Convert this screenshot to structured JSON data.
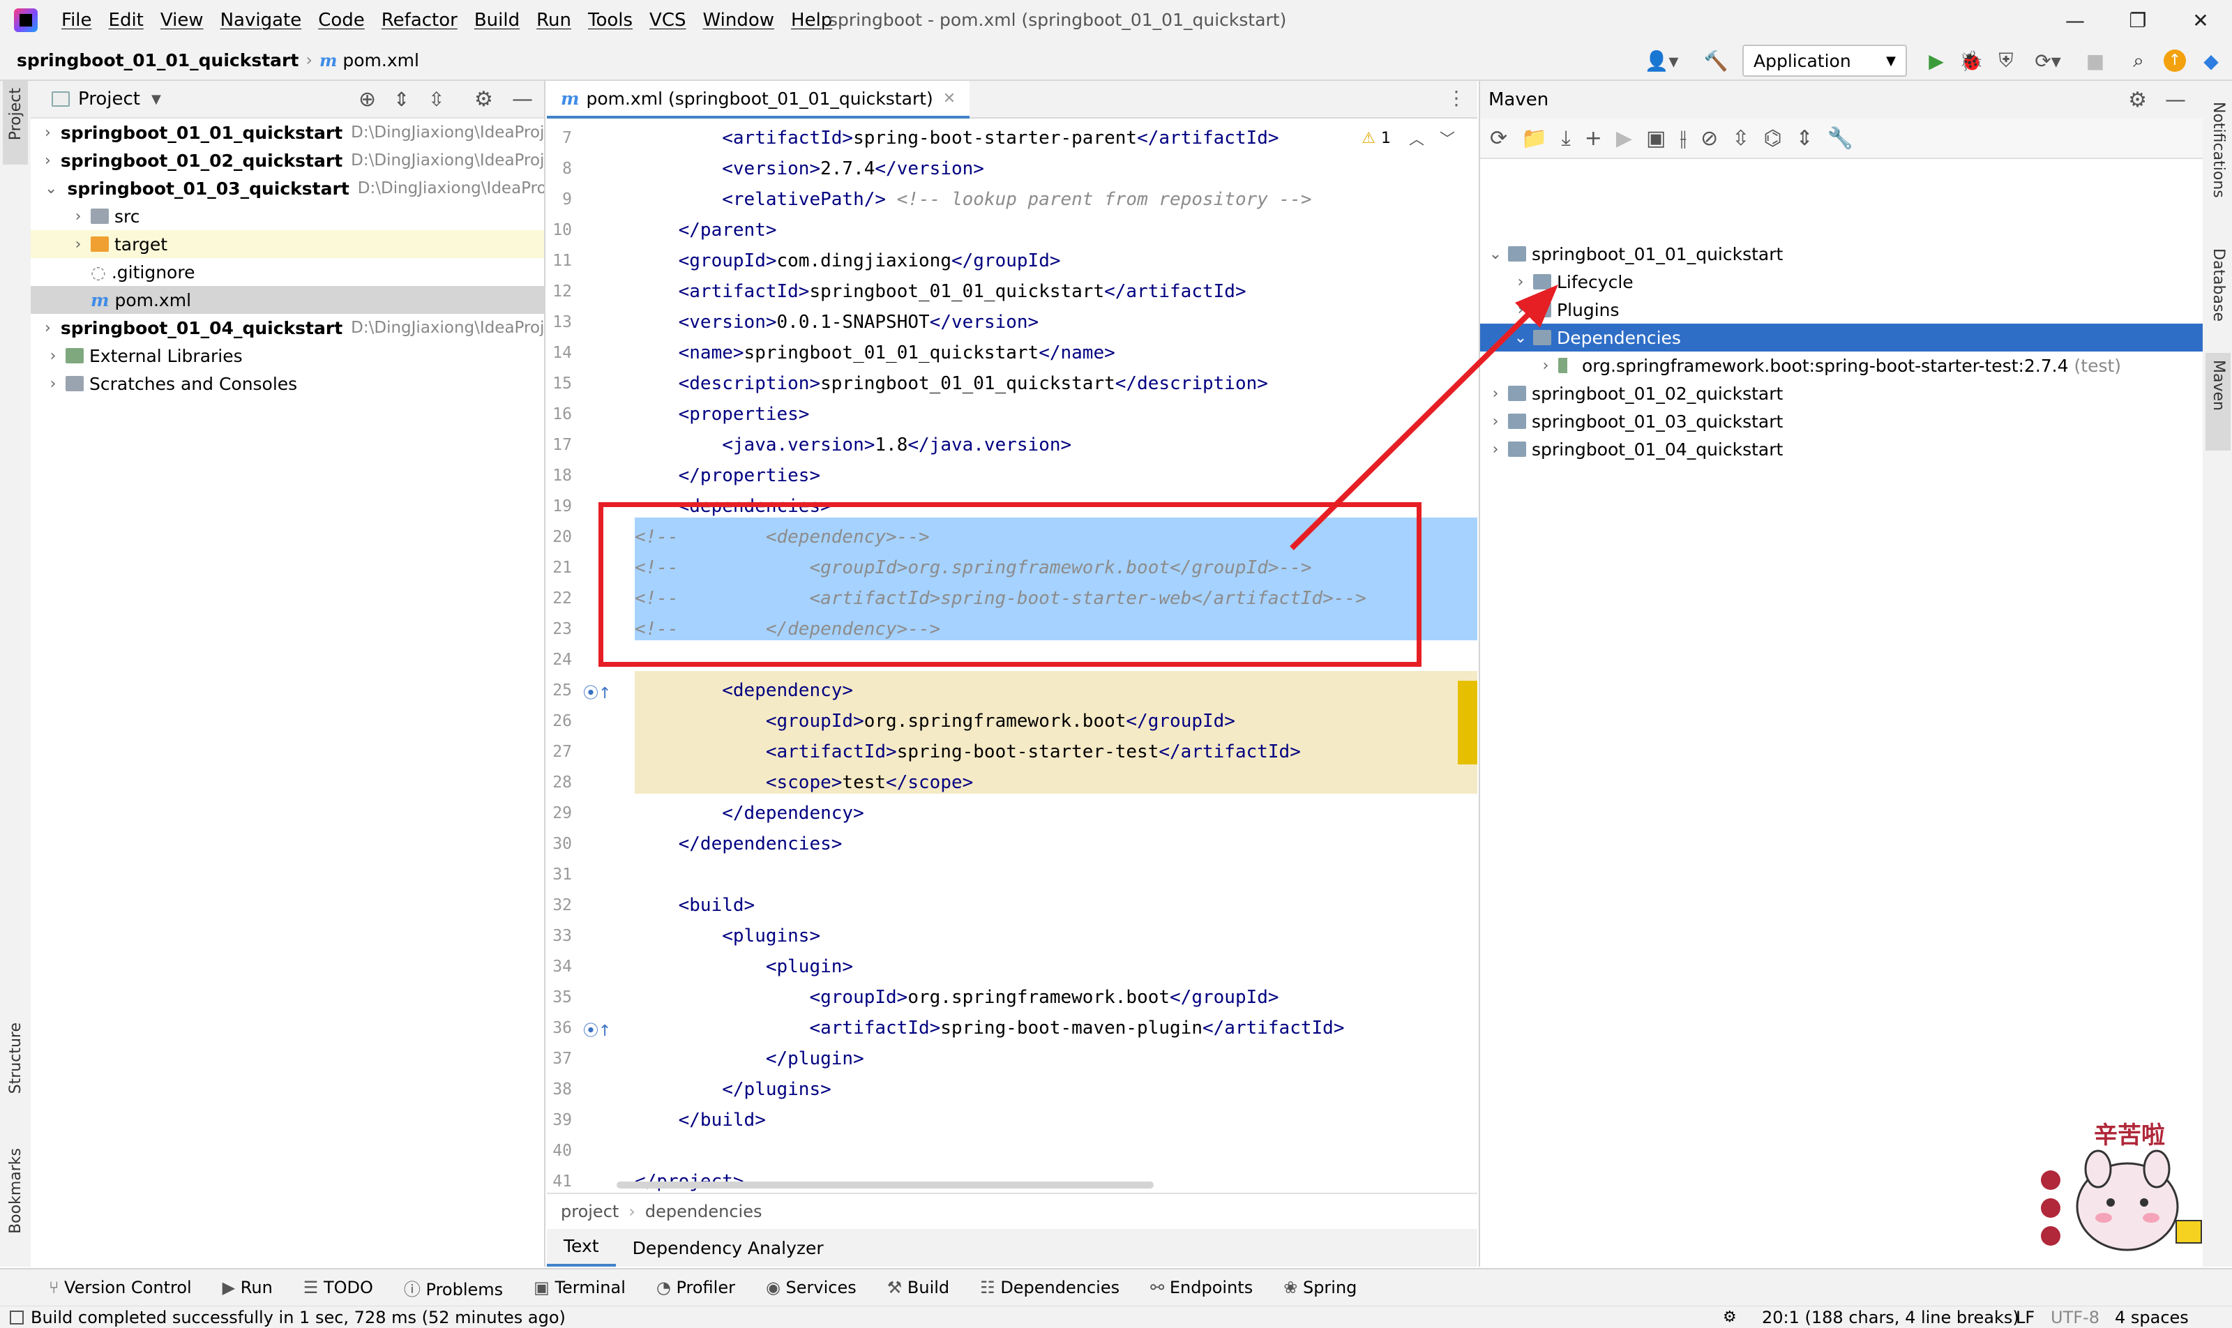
{
  "menu": [
    "File",
    "Edit",
    "View",
    "Navigate",
    "Code",
    "Refactor",
    "Build",
    "Run",
    "Tools",
    "VCS",
    "Window",
    "Help"
  ],
  "window_title": "springboot - pom.xml (springboot_01_01_quickstart)",
  "breadcrumb": {
    "project": "springboot_01_01_quickstart",
    "file": "pom.xml"
  },
  "run_config": "Application",
  "project_panel": {
    "title": "Project",
    "rows": [
      {
        "label": "springboot_01_01_quickstart",
        "path": "D:\\DingJiaxiong\\IdeaProje",
        "bold": true
      },
      {
        "label": "springboot_01_02_quickstart",
        "path": "D:\\DingJiaxiong\\IdeaProje",
        "bold": true
      },
      {
        "label": "springboot_01_03_quickstart",
        "path": "D:\\DingJiaxiong\\IdeaProje",
        "bold": true
      },
      {
        "label": "src"
      },
      {
        "label": "target"
      },
      {
        "label": ".gitignore"
      },
      {
        "label": "pom.xml"
      },
      {
        "label": "springboot_01_04_quickstart",
        "path": "D:\\DingJiaxiong\\IdeaProje",
        "bold": true
      },
      {
        "label": "External Libraries"
      },
      {
        "label": "Scratches and Consoles"
      }
    ]
  },
  "left_stripe": {
    "top": "Project",
    "structure": "Structure",
    "bookmarks": "Bookmarks"
  },
  "right_stripe": {
    "notifications": "Notifications",
    "database": "Database",
    "maven": "Maven"
  },
  "editor": {
    "tab": "pom.xml (springboot_01_01_quickstart)",
    "warning_count": "1",
    "lines": [
      {
        "n": "7",
        "t": "        <artifactId>spring-boot-starter-parent</artifactId>"
      },
      {
        "n": "8",
        "t": "        <version>2.7.4</version>"
      },
      {
        "n": "9",
        "t": "        <relativePath/> <!-- lookup parent from repository -->"
      },
      {
        "n": "10",
        "t": "    </parent>"
      },
      {
        "n": "11",
        "t": "    <groupId>com.dingjiaxiong</groupId>"
      },
      {
        "n": "12",
        "t": "    <artifactId>springboot_01_01_quickstart</artifactId>"
      },
      {
        "n": "13",
        "t": "    <version>0.0.1-SNAPSHOT</version>"
      },
      {
        "n": "14",
        "t": "    <name>springboot_01_01_quickstart</name>"
      },
      {
        "n": "15",
        "t": "    <description>springboot_01_01_quickstart</description>"
      },
      {
        "n": "16",
        "t": "    <properties>"
      },
      {
        "n": "17",
        "t": "        <java.version>1.8</java.version>"
      },
      {
        "n": "18",
        "t": "    </properties>"
      },
      {
        "n": "19",
        "t": "    <dependencies>"
      },
      {
        "n": "20",
        "t": "<!--        <dependency>-->"
      },
      {
        "n": "21",
        "t": "<!--            <groupId>org.springframework.boot</groupId>-->"
      },
      {
        "n": "22",
        "t": "<!--            <artifactId>spring-boot-starter-web</artifactId>-->"
      },
      {
        "n": "23",
        "t": "<!--        </dependency>-->"
      },
      {
        "n": "24",
        "t": ""
      },
      {
        "n": "25",
        "t": "        <dependency>"
      },
      {
        "n": "26",
        "t": "            <groupId>org.springframework.boot</groupId>"
      },
      {
        "n": "27",
        "t": "            <artifactId>spring-boot-starter-test</artifactId>"
      },
      {
        "n": "28",
        "t": "            <scope>test</scope>"
      },
      {
        "n": "29",
        "t": "        </dependency>"
      },
      {
        "n": "30",
        "t": "    </dependencies>"
      },
      {
        "n": "31",
        "t": ""
      },
      {
        "n": "32",
        "t": "    <build>"
      },
      {
        "n": "33",
        "t": "        <plugins>"
      },
      {
        "n": "34",
        "t": "            <plugin>"
      },
      {
        "n": "35",
        "t": "                <groupId>org.springframework.boot</groupId>"
      },
      {
        "n": "36",
        "t": "                <artifactId>spring-boot-maven-plugin</artifactId>"
      },
      {
        "n": "37",
        "t": "            </plugin>"
      },
      {
        "n": "38",
        "t": "        </plugins>"
      },
      {
        "n": "39",
        "t": "    </build>"
      },
      {
        "n": "40",
        "t": ""
      },
      {
        "n": "41",
        "t": "</project>"
      }
    ],
    "breadcrumb": [
      "project",
      "dependencies"
    ],
    "bottom_tabs": [
      "Text",
      "Dependency Analyzer"
    ]
  },
  "maven": {
    "title": "Maven",
    "rows": [
      {
        "label": "springboot_01_01_quickstart"
      },
      {
        "label": "Lifecycle"
      },
      {
        "label": "Plugins"
      },
      {
        "label": "Dependencies",
        "selected": true
      },
      {
        "label": "org.springframework.boot:spring-boot-starter-test:2.7.4",
        "suffix": "(test)"
      },
      {
        "label": "springboot_01_02_quickstart"
      },
      {
        "label": "springboot_01_03_quickstart"
      },
      {
        "label": "springboot_01_04_quickstart"
      }
    ]
  },
  "tool_windows": [
    "Version Control",
    "Run",
    "TODO",
    "Problems",
    "Terminal",
    "Profiler",
    "Services",
    "Build",
    "Dependencies",
    "Endpoints",
    "Spring"
  ],
  "status": {
    "message": "Build completed successfully in 1 sec, 728 ms (52 minutes ago)",
    "position": "20:1 (188 chars, 4 line breaks)",
    "line_sep": "LF",
    "encoding": "UTF-8",
    "indent": "4 spaces"
  },
  "sticker_text": "辛苦啦"
}
